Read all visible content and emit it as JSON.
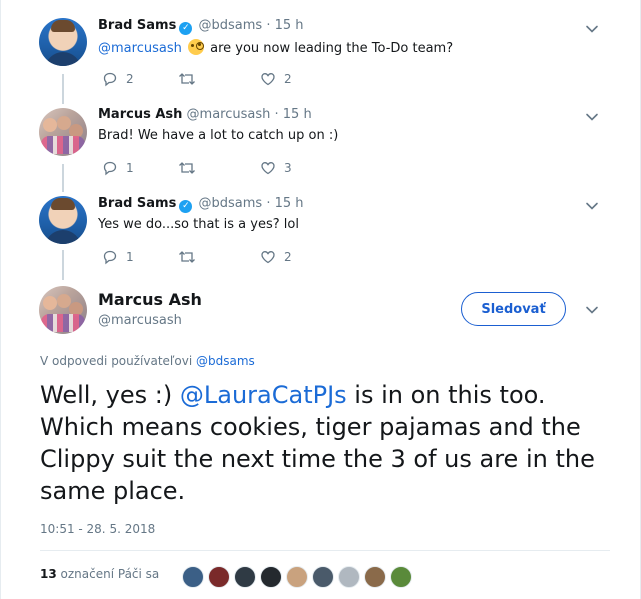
{
  "thread": [
    {
      "name": "Brad Sams",
      "verified": true,
      "handle": "@bdsams",
      "time": "· 15 h",
      "mention": "@marcusash",
      "text": " are you now leading the To-Do team?",
      "emoji": "face-with-monocle",
      "replies": "2",
      "retweets": "",
      "likes": "2"
    },
    {
      "name": "Marcus Ash",
      "verified": false,
      "handle": "@marcusash",
      "time": "· 15 h",
      "text": "Brad! We have a lot to catch up on :)",
      "replies": "1",
      "retweets": "",
      "likes": "3"
    },
    {
      "name": "Brad Sams",
      "verified": true,
      "handle": "@bdsams",
      "time": "· 15 h",
      "text": "Yes we do...so that is a yes? lol",
      "replies": "1",
      "retweets": "",
      "likes": "2"
    }
  ],
  "main": {
    "name": "Marcus Ash",
    "handle": "@marcusash",
    "follow_label": "Sledovať",
    "reply_prefix": "V odpovedi používateľovi ",
    "reply_to": "@bdsams",
    "text_before": "Well, yes :) ",
    "text_mention": "@LauraCatPJs",
    "text_after": " is in on this too. Which means cookies, tiger pajamas and the Clippy suit the next time the 3 of us are in the same place.",
    "timestamp": "10:51 - 28. 5. 2018",
    "like_count": "13",
    "like_label": "označení Páči sa",
    "likers": [
      "#3b5f86",
      "#7a2a2a",
      "#2f3a44",
      "#24292e",
      "#c9a27e",
      "#4a5a6a",
      "#b0b8c0",
      "#8a6a4a",
      "#5a8a3a"
    ]
  },
  "colors": {
    "accent": "#1da1f2",
    "link": "#1b6bd6",
    "muted": "#657786"
  }
}
